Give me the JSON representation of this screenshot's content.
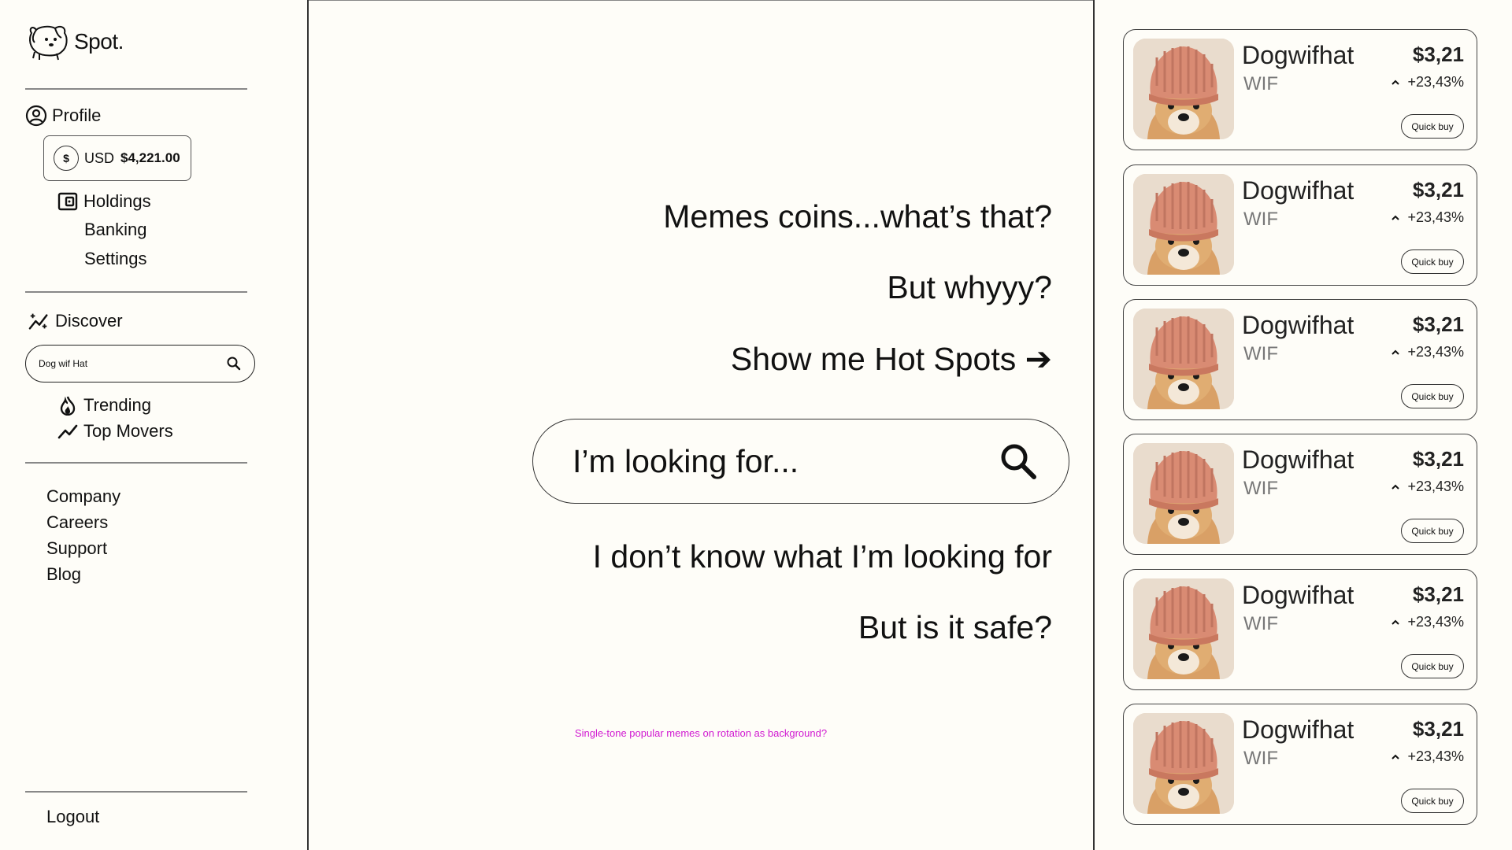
{
  "brand": {
    "name": "Spot."
  },
  "sidebar": {
    "profile_label": "Profile",
    "balance": {
      "currency_symbol": "$",
      "currency": "USD",
      "amount": "$4,221.00"
    },
    "account_items": [
      {
        "label": "Holdings"
      },
      {
        "label": "Banking"
      },
      {
        "label": "Settings"
      }
    ],
    "discover_label": "Discover",
    "search_value": "Dog wif Hat",
    "discover_items": [
      {
        "label": "Trending"
      },
      {
        "label": "Top Movers"
      }
    ],
    "footer_links": [
      {
        "label": "Company"
      },
      {
        "label": "Careers"
      },
      {
        "label": "Support"
      },
      {
        "label": "Blog"
      }
    ],
    "logout_label": "Logout"
  },
  "main": {
    "prompts": [
      "Memes coins...what’s that?",
      "But whyyy?",
      "Show me Hot Spots ➔"
    ],
    "search_placeholder": "I’m looking for...",
    "prompts_below": [
      "I don’t know what I’m looking for",
      "But is it safe?"
    ],
    "note": "Single-tone popular memes on rotation as background?"
  },
  "coins": [
    {
      "name": "Dogwifhat",
      "ticker": "WIF",
      "price": "$3,21",
      "change": "+23,43%",
      "action": "Quick buy"
    },
    {
      "name": "Dogwifhat",
      "ticker": "WIF",
      "price": "$3,21",
      "change": "+23,43%",
      "action": "Quick buy"
    },
    {
      "name": "Dogwifhat",
      "ticker": "WIF",
      "price": "$3,21",
      "change": "+23,43%",
      "action": "Quick buy"
    },
    {
      "name": "Dogwifhat",
      "ticker": "WIF",
      "price": "$3,21",
      "change": "+23,43%",
      "action": "Quick buy"
    },
    {
      "name": "Dogwifhat",
      "ticker": "WIF",
      "price": "$3,21",
      "change": "+23,43%",
      "action": "Quick buy"
    },
    {
      "name": "Dogwifhat",
      "ticker": "WIF",
      "price": "$3,21",
      "change": "+23,43%",
      "action": "Quick buy"
    }
  ],
  "colors": {
    "background": "#fefdf8",
    "note": "#d11ad1",
    "border": "#333333"
  }
}
